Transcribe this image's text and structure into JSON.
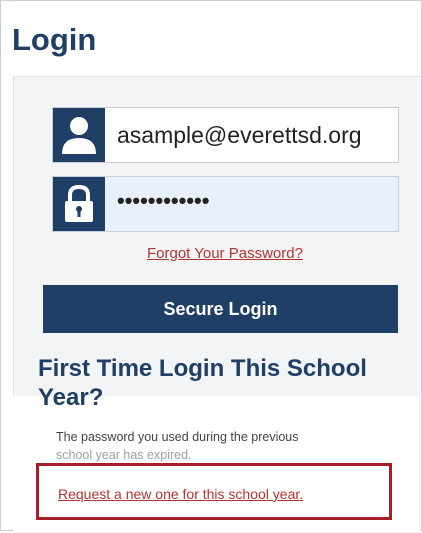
{
  "header": {
    "title": "Login"
  },
  "form": {
    "username": {
      "value": "asample@everettsd.org",
      "icon": "user-icon"
    },
    "password": {
      "value": "••••••••••••",
      "icon": "lock-icon"
    },
    "forgot_password_label": "Forgot Your Password?",
    "submit_label": "Secure Login"
  },
  "first_time": {
    "heading": "First Time Login This School Year?",
    "info_line1": "The password you used during the previous",
    "info_line2": "school year has expired.",
    "request_link": "Request a new one for this school year."
  },
  "colors": {
    "brand_navy": "#1f3f66",
    "link_red": "#b5342d",
    "highlight_red": "#a71e24",
    "password_field_bg": "#e9f0fd"
  }
}
